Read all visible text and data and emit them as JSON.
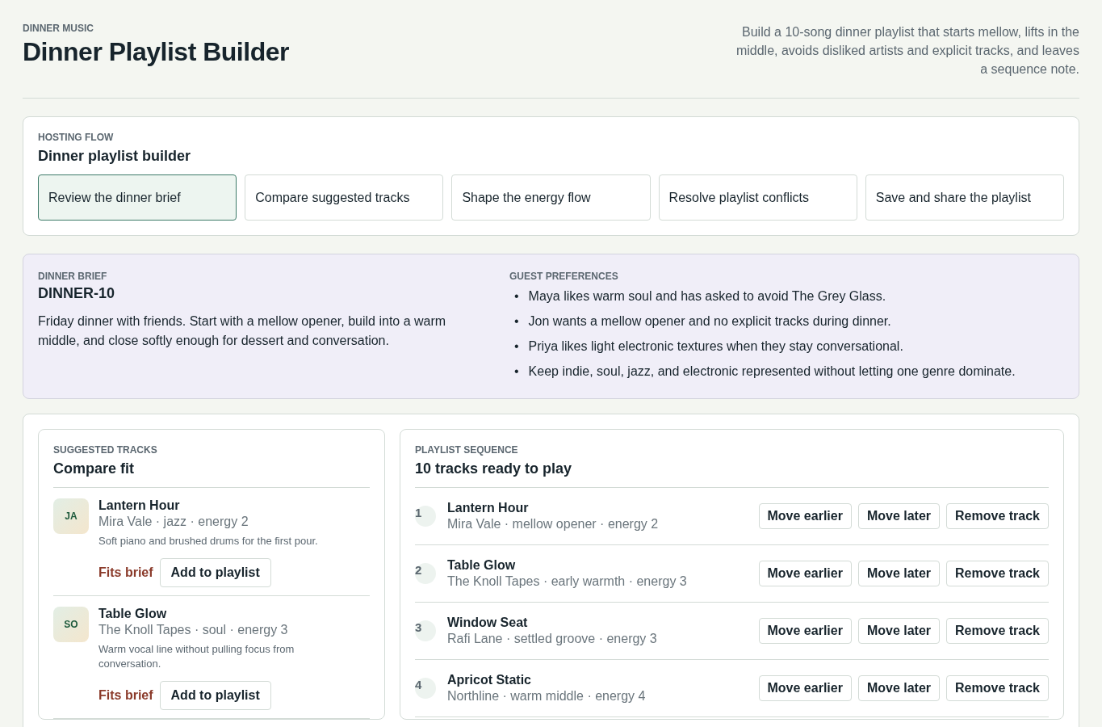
{
  "header": {
    "eyebrow": "DINNER MUSIC",
    "title": "Dinner Playlist Builder",
    "description": "Build a 10-song dinner playlist that starts mellow, lifts in the middle, avoids disliked artists and explicit tracks, and leaves a sequence note."
  },
  "flow": {
    "eyebrow": "HOSTING FLOW",
    "title": "Dinner playlist builder",
    "steps": [
      {
        "label": "Review the dinner brief",
        "selected": true
      },
      {
        "label": "Compare suggested tracks",
        "selected": false
      },
      {
        "label": "Shape the energy flow",
        "selected": false
      },
      {
        "label": "Resolve playlist conflicts",
        "selected": false
      },
      {
        "label": "Save and share the playlist",
        "selected": false
      }
    ]
  },
  "brief": {
    "eyebrow": "DINNER BRIEF",
    "code": "DINNER-10",
    "text": "Friday dinner with friends. Start with a mellow opener, build into a warm middle, and close softly enough for dessert and conversation."
  },
  "preferences": {
    "eyebrow": "GUEST PREFERENCES",
    "items": [
      {
        "marker": "•",
        "text": "Maya likes warm soul and has asked to avoid The Grey Glass."
      },
      {
        "marker": "•",
        "text": "Jon wants a mellow opener and no explicit tracks during dinner."
      },
      {
        "marker": "•",
        "text": "Priya likes light electronic textures when they stay conversational."
      },
      {
        "marker": "•",
        "text": "Keep indie, soul, jazz, and electronic represented without letting one genre dominate."
      }
    ]
  },
  "suggested": {
    "eyebrow": "SUGGESTED TRACKS",
    "title": "Compare fit",
    "tracks": [
      {
        "initials": "JA",
        "title": "Lantern Hour",
        "meta": "Mira Vale · jazz · energy 2",
        "note": "Soft piano and brushed drums for the first pour.",
        "fit": "Fits brief",
        "action": "Add to playlist"
      },
      {
        "initials": "SO",
        "title": "Table Glow",
        "meta": "The Knoll Tapes · soul · energy 3",
        "note": "Warm vocal line without pulling focus from conversation.",
        "fit": "Fits brief",
        "action": "Add to playlist"
      }
    ]
  },
  "sequence": {
    "eyebrow": "PLAYLIST SEQUENCE",
    "title": "10 tracks ready to play",
    "tracks": [
      {
        "number": "1",
        "title": "Lantern Hour",
        "meta": "Mira Vale · mellow opener · energy 2",
        "actions": [
          "Move earlier",
          "Move later",
          "Remove track"
        ]
      },
      {
        "number": "2",
        "title": "Table Glow",
        "meta": "The Knoll Tapes · early warmth · energy 3",
        "actions": [
          "Move earlier",
          "Move later",
          "Remove track"
        ]
      },
      {
        "number": "3",
        "title": "Window Seat",
        "meta": "Rafi Lane · settled groove · energy 3",
        "actions": [
          "Move earlier",
          "Move later",
          "Remove track"
        ]
      },
      {
        "number": "4",
        "title": "Apricot Static",
        "meta": "Northline · warm middle · energy 4",
        "actions": [
          "Move earlier",
          "Move later",
          "Remove track"
        ]
      }
    ]
  }
}
